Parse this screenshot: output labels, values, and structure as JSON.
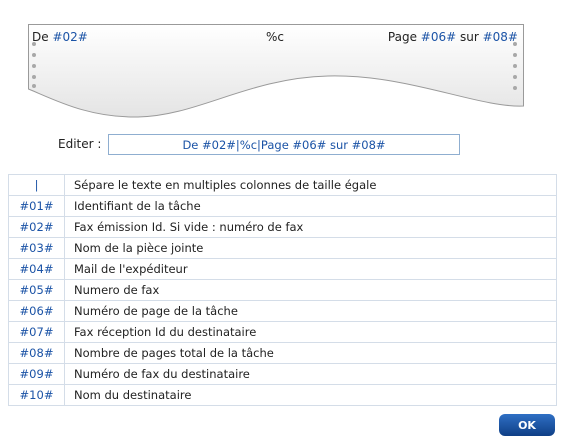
{
  "preview": {
    "left_prefix": "De ",
    "left_code": "#02#",
    "center_text": "%c",
    "right_prefix": "Page ",
    "right_code1": "#06#",
    "right_mid": " sur ",
    "right_code2": "#08#"
  },
  "editor": {
    "label": "Editer :",
    "value": "De #02#|%c|Page #06# sur #08#"
  },
  "codes": [
    {
      "code": "|",
      "description": "Sépare le texte en multiples colonnes de taille égale"
    },
    {
      "code": "#01#",
      "description": "Identifiant de la tâche"
    },
    {
      "code": "#02#",
      "description": "Fax émission Id. Si vide : numéro de fax"
    },
    {
      "code": "#03#",
      "description": "Nom de la pièce jointe"
    },
    {
      "code": "#04#",
      "description": "Mail de l'expéditeur"
    },
    {
      "code": "#05#",
      "description": "Numero de fax"
    },
    {
      "code": "#06#",
      "description": "Numéro de page de la tâche"
    },
    {
      "code": "#07#",
      "description": "Fax réception Id du destinataire"
    },
    {
      "code": "#08#",
      "description": "Nombre de pages total de la tâche"
    },
    {
      "code": "#09#",
      "description": "Numéro de fax du destinataire"
    },
    {
      "code": "#10#",
      "description": "Nom du destinataire"
    }
  ],
  "ok_label": "OK",
  "colors": {
    "code_blue": "#1b53a6",
    "button_blue": "#1a4f9e",
    "table_border": "#d4dde8"
  }
}
